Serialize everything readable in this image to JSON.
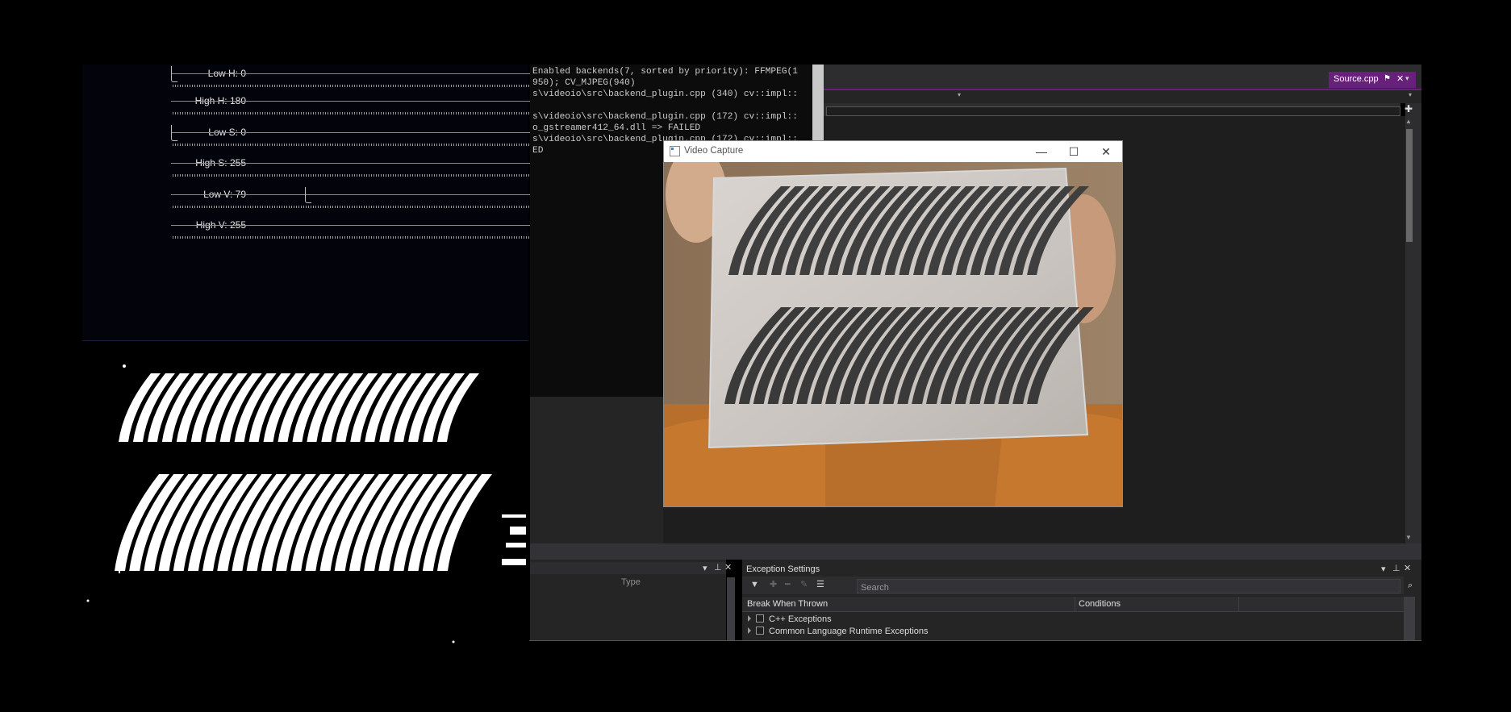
{
  "trackbars": [
    {
      "label": "Low H: 0",
      "fraction": 0.0
    },
    {
      "label": "High H: 180",
      "fraction": 1.0
    },
    {
      "label": "Low S: 0",
      "fraction": 0.0
    },
    {
      "label": "High S: 255",
      "fraction": 1.0
    },
    {
      "label": "Low V: 79",
      "fraction": 0.31
    },
    {
      "label": "High V: 255",
      "fraction": 1.0
    }
  ],
  "console": {
    "lines": [
      "Enabled backends(7, sorted by priority): FFMPEG(1",
      "950); CV_MJPEG(940)",
      "s\\videoio\\src\\backend_plugin.cpp (340) cv::impl::",
      "",
      "s\\videoio\\src\\backend_plugin.cpp (172) cv::impl::",
      "o_gstreamer412_64.dll => FAILED",
      "s\\videoio\\src\\backend_plugin.cpp (172) cv::impl::",
      "ED"
    ]
  },
  "editor": {
    "tab_label": "Source.cpp",
    "tab_pin": "⚑",
    "tab_close": "✕"
  },
  "video_window": {
    "title": "Video Capture",
    "minimize": "—",
    "maximize": "☐",
    "close": "✕"
  },
  "locals_panel": {
    "type_header": "Type"
  },
  "exception_settings": {
    "title": "Exception Settings",
    "search_placeholder": "Search",
    "columns": [
      "Break When Thrown",
      "Conditions"
    ],
    "rows": [
      "C++ Exceptions",
      "Common Language Runtime Exceptions"
    ]
  },
  "icons": {
    "filter": "filter-icon",
    "add": "add-icon",
    "remove": "remove-icon",
    "edit": "edit-icon",
    "list": "list-icon",
    "search": "search-icon"
  }
}
